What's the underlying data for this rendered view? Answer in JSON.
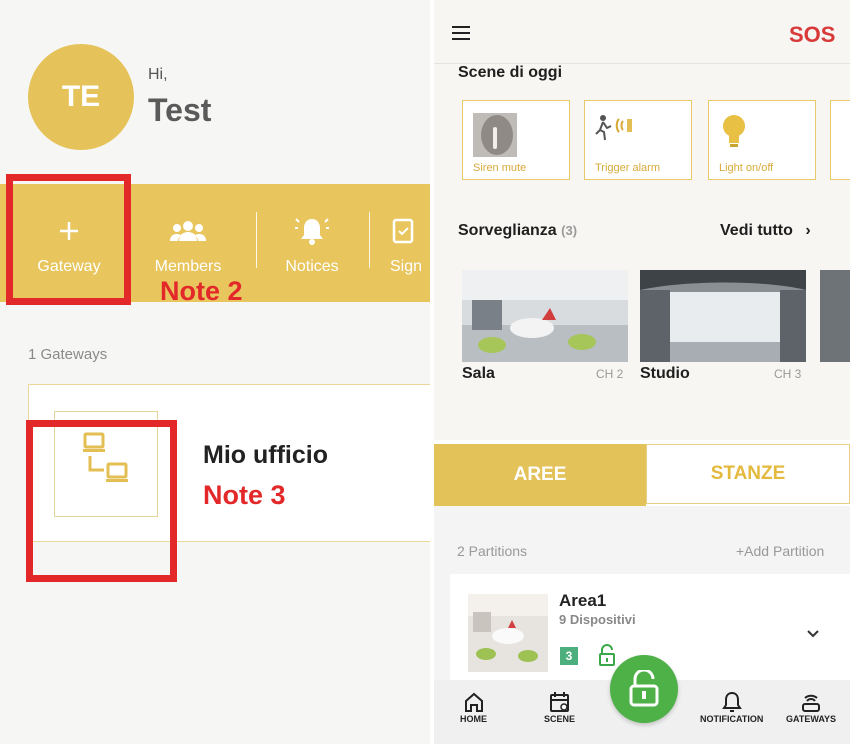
{
  "left": {
    "avatar_initials": "TE",
    "greeting": "Hi,",
    "username": "Test",
    "actions": [
      {
        "label": "Gateway",
        "icon": "plus-icon"
      },
      {
        "label": "Members",
        "icon": "members-icon"
      },
      {
        "label": "Notices",
        "icon": "bell-icon"
      },
      {
        "label": "Sign",
        "icon": "sign-icon"
      }
    ],
    "note2": "Note 2",
    "note3": "Note 3",
    "gateway_count": "1 Gateways",
    "gateway_name": "Mio ufficio",
    "gateway_icon": "network-icon"
  },
  "right": {
    "sos_label": "SOS",
    "scene_title": "Scene di oggi",
    "scenes": [
      {
        "label": "Siren mute",
        "icon": "shush-icon"
      },
      {
        "label": "Trigger alarm",
        "icon": "alarm-person-icon"
      },
      {
        "label": "Light on/off",
        "icon": "bulb-icon"
      }
    ],
    "surveillance": {
      "title": "Sorveglianza",
      "count": "(3)",
      "see_all": "Vedi tutto",
      "see_all_arrow": "›",
      "cameras": [
        {
          "name": "Sala",
          "channel": "CH 2"
        },
        {
          "name": "Studio",
          "channel": "CH 3"
        }
      ]
    },
    "tabs": {
      "aree": "AREE",
      "stanze": "STANZE"
    },
    "partitions": {
      "count": "2 Partitions",
      "add": "+Add Partition",
      "area_name": "Area1",
      "area_devices": "9 Dispositivi",
      "badge": "3"
    },
    "nav": {
      "home": "HOME",
      "scene": "SCENE",
      "notification": "NOTIFICATION",
      "gateways": "GATEWAYS"
    }
  },
  "colors": {
    "accent_gold": "#e8c55d",
    "note_red": "#e3282a",
    "fab_green": "#4db148"
  }
}
